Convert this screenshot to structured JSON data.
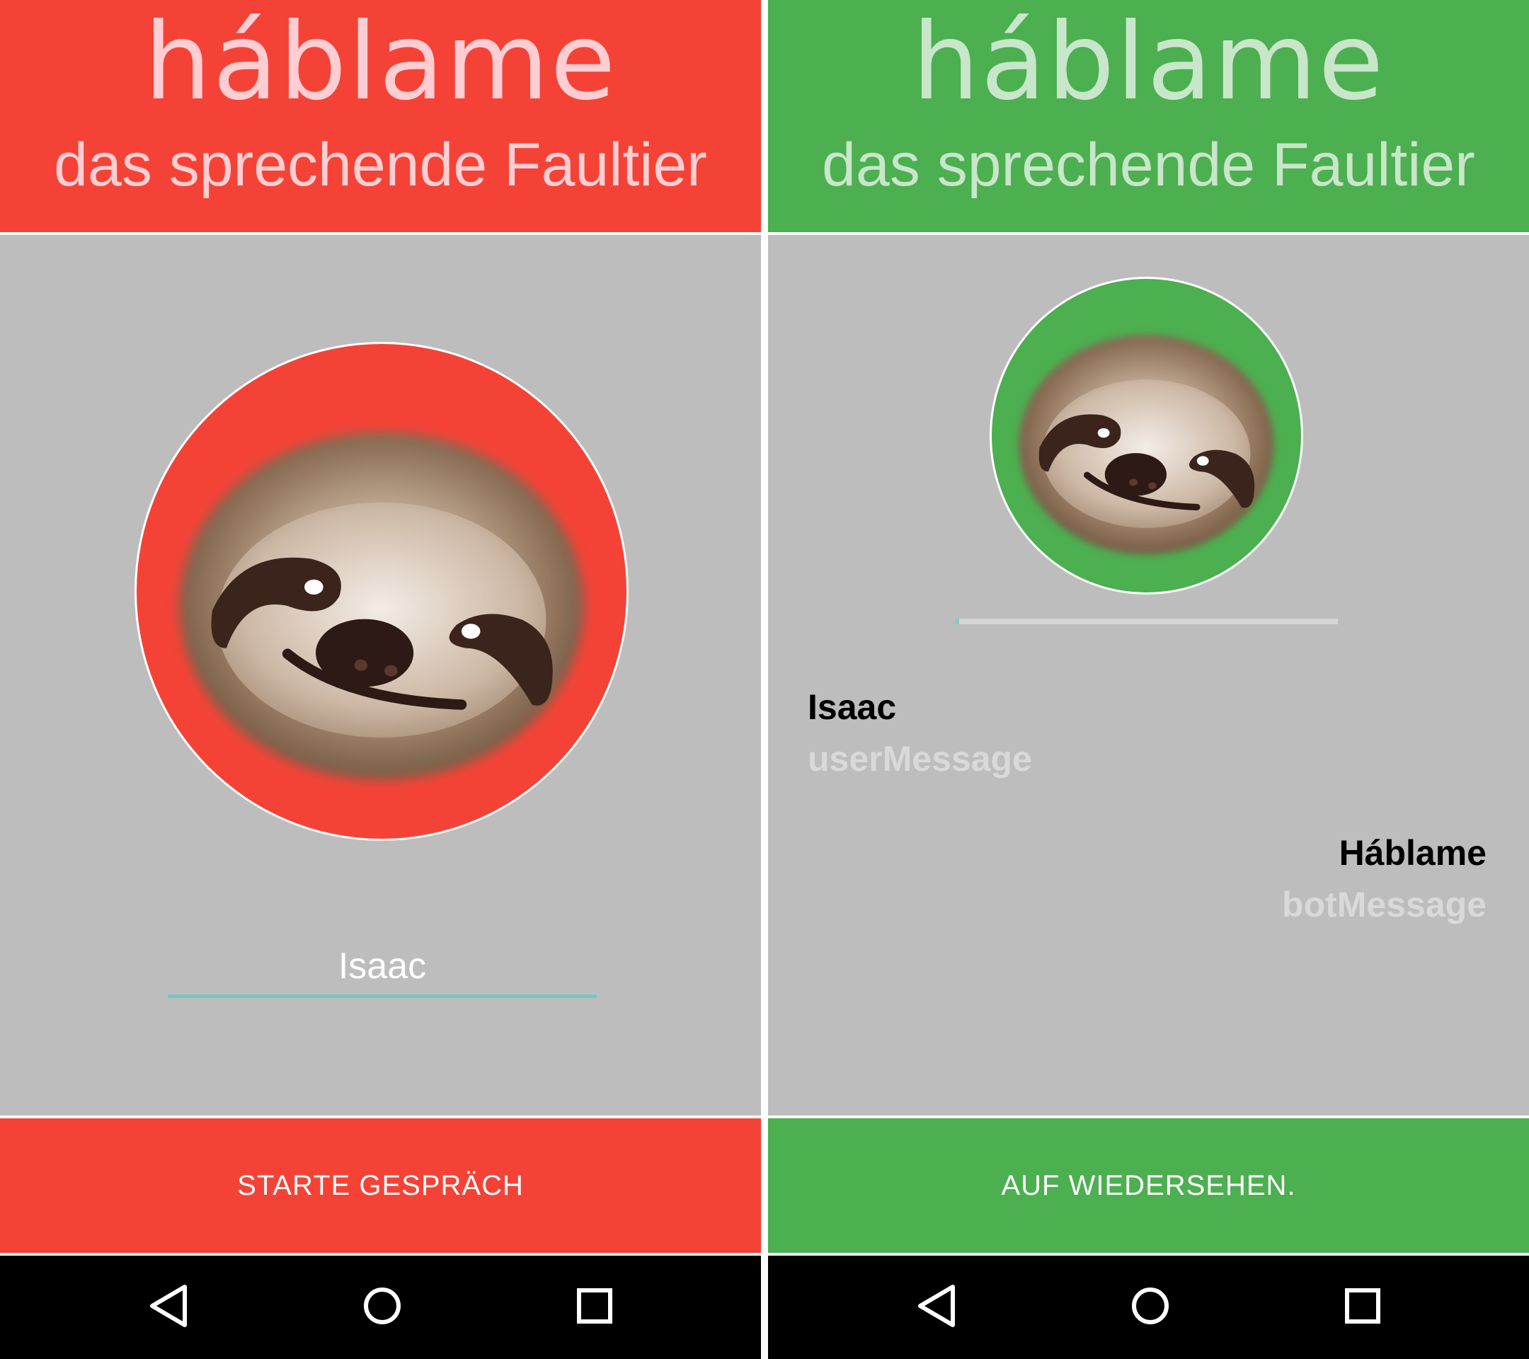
{
  "colors": {
    "red": "#f44336",
    "green": "#4caf50",
    "content_bg": "#bdbdbd",
    "title_red": "#ffcdd2",
    "title_green": "#c8e6c9",
    "accent_line": "#76c7c0"
  },
  "left_screen": {
    "header": {
      "title": "háblame",
      "subtitle": "das sprechende Faultier"
    },
    "avatar": {
      "icon": "sloth-face-icon"
    },
    "name_input": {
      "value": "Isaac"
    },
    "action_button": {
      "label": "STARTE GESPRÄCH"
    },
    "navigation": {
      "back": "back-icon",
      "home": "home-icon",
      "recents": "recents-icon"
    }
  },
  "right_screen": {
    "header": {
      "title": "háblame",
      "subtitle": "das sprechende Faultier"
    },
    "avatar": {
      "icon": "sloth-face-icon"
    },
    "progress": {
      "fraction": 0.01
    },
    "user_message": {
      "name": "Isaac",
      "text": "userMessage"
    },
    "bot_message": {
      "name": "Háblame",
      "text": "botMessage"
    },
    "action_button": {
      "label": "AUF WIEDERSEHEN."
    },
    "navigation": {
      "back": "back-icon",
      "home": "home-icon",
      "recents": "recents-icon"
    }
  }
}
